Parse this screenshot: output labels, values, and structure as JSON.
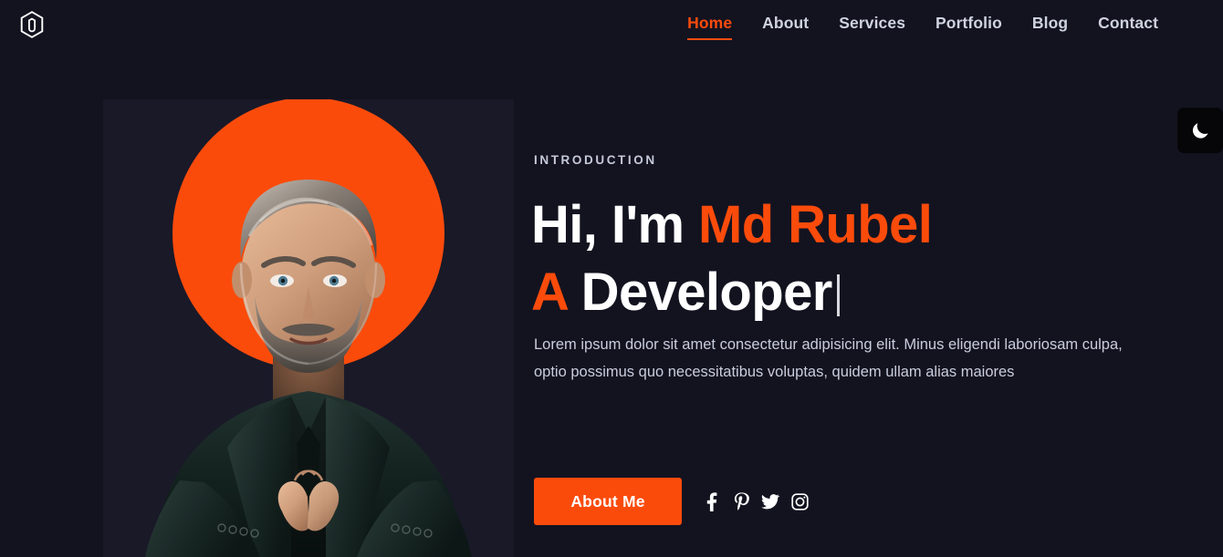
{
  "site": {
    "logo_icon": "magento-hexagon-logo-icon",
    "background_color": "#131320",
    "accent_color": "#fb4b0b",
    "text_color": "#cfd3e0"
  },
  "header": {
    "nav": [
      {
        "label": "Home",
        "active": true
      },
      {
        "label": "About",
        "active": false
      },
      {
        "label": "Services",
        "active": false
      },
      {
        "label": "Portfolio",
        "active": false
      },
      {
        "label": "Blog",
        "active": false
      },
      {
        "label": "Contact",
        "active": false
      }
    ]
  },
  "hero": {
    "eyebrow": "INTRODUCTION",
    "headline_line1_plain": "Hi, I'm ",
    "headline_line1_accent": "Md Rubel",
    "headline_line2_accent": "A",
    "headline_line2_plain": " Developer",
    "paragraph": "Lorem ipsum dolor sit amet consectetur adipisicing elit. Minus eligendi laboriosam culpa, optio possimus quo necessitatibus voluptas, quidem ullam alias maiores",
    "cta_label": "About Me",
    "photo_alt": "Portrait of a bearded man in a dark suit with hands clasped, orange circle backdrop",
    "circle_color": "#fb4b0b",
    "panel_color": "#191928",
    "socials": [
      {
        "name": "facebook",
        "icon": "facebook-icon"
      },
      {
        "name": "pinterest",
        "icon": "pinterest-icon"
      },
      {
        "name": "twitter",
        "icon": "twitter-icon"
      },
      {
        "name": "instagram",
        "icon": "instagram-icon"
      }
    ]
  },
  "theme_toggle": {
    "icon": "moon-icon",
    "mode": "dark"
  }
}
